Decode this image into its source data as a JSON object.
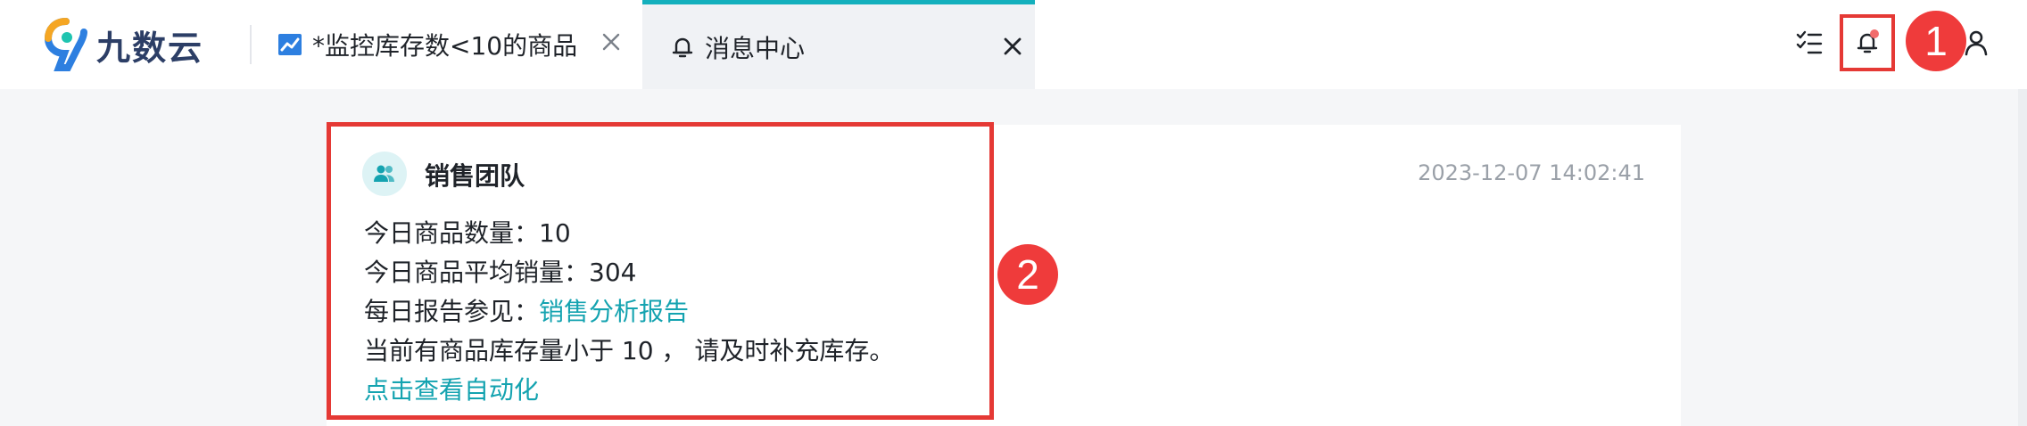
{
  "app": {
    "logo_text": "九数云"
  },
  "tabs": [
    {
      "label": "*监控库存数<10的商品",
      "icon": "line-chart-icon",
      "active": false
    },
    {
      "label": "消息中心",
      "icon": "bell-icon",
      "active": true
    }
  ],
  "header_icons": [
    "task-list-icon",
    "bell-icon",
    "user-icon"
  ],
  "annotations": {
    "step_1": "1",
    "step_2": "2"
  },
  "message": {
    "sender": "销售团队",
    "timestamp": "2023-12-07 14:02:41",
    "line1": "今日商品数量：10",
    "line2": "今日商品平均销量：304",
    "line3_prefix": "每日报告参见：",
    "line3_link": "销售分析报告",
    "line4": "当前有商品库存量小于 10 ， 请及时补充库存。",
    "action_link": "点击查看自动化"
  },
  "colors": {
    "accent": "#14a3b0",
    "tab_active_border": "#14b0bd",
    "annotation_red": "#e53935",
    "badge_red": "#ef3b3b",
    "notification_dot": "#f26c6c"
  }
}
